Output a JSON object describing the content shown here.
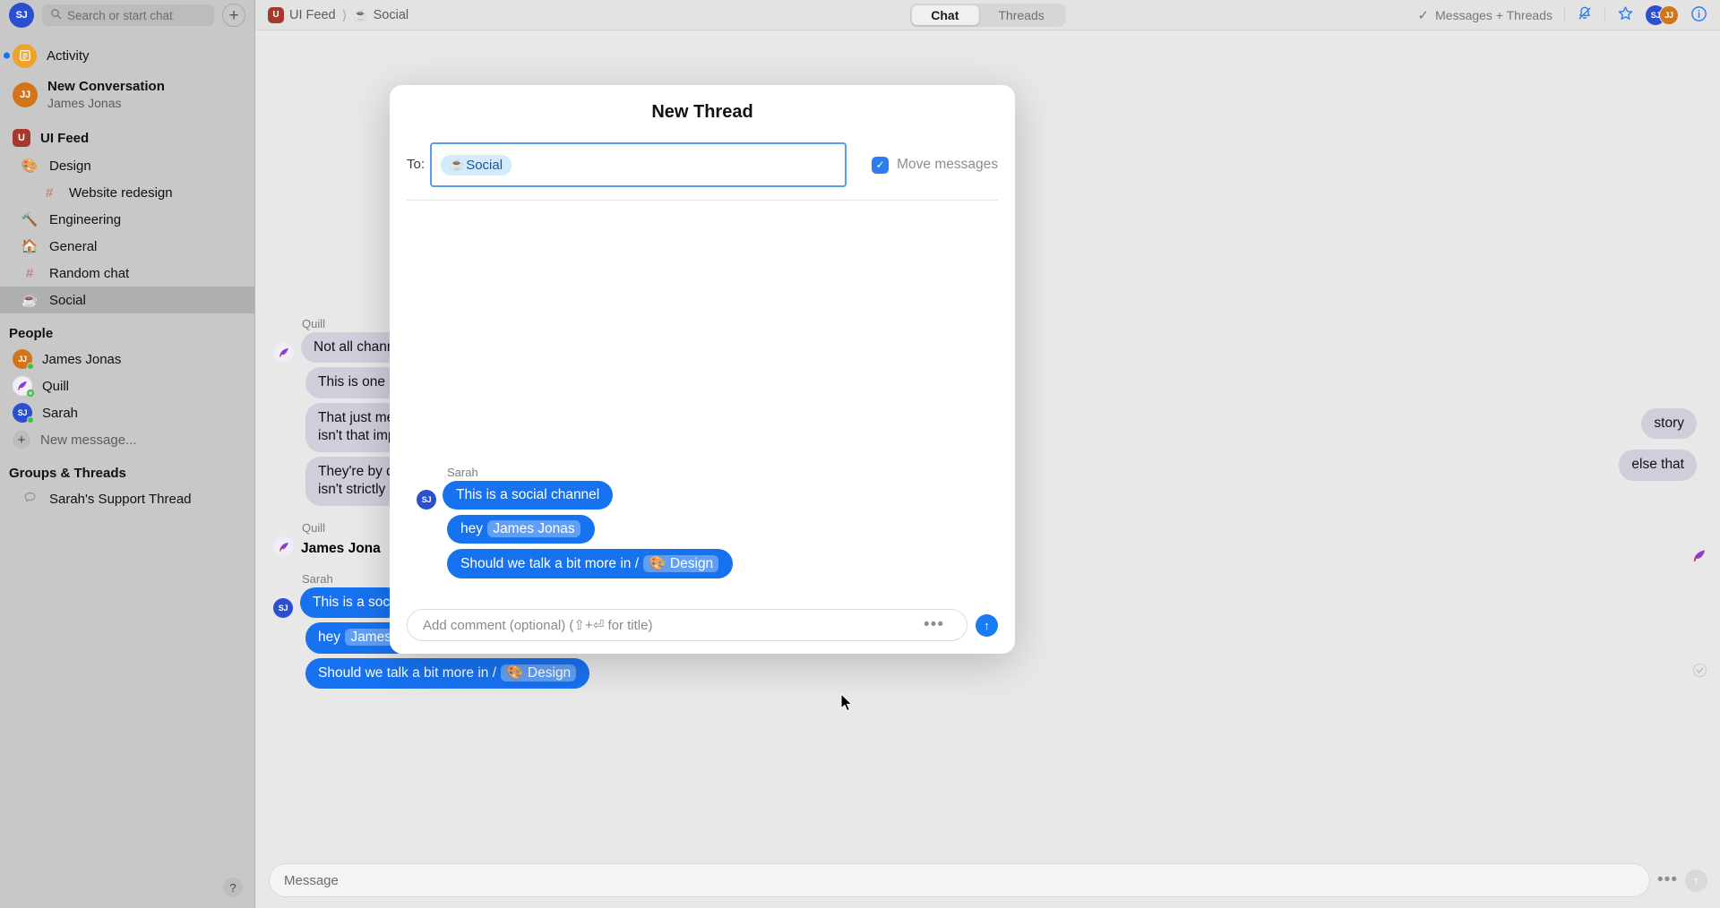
{
  "sidebar": {
    "account_initials": "SJ",
    "search": {
      "placeholder": "Search or start chat",
      "icon": "search-icon"
    },
    "new_button": "+",
    "activity": {
      "label": "Activity",
      "icon": "activity-icon"
    },
    "conversation": {
      "title": "New Conversation",
      "subtitle": "James Jonas",
      "initials": "JJ"
    },
    "workspace": {
      "label": "UI Feed",
      "badge": "U"
    },
    "channels": [
      {
        "label": "Design",
        "icon": "🎨",
        "indent": 1,
        "selected": false
      },
      {
        "label": "Website redesign",
        "icon": "#",
        "indent": 2,
        "selected": false
      },
      {
        "label": "Engineering",
        "icon": "🔨",
        "indent": 1,
        "selected": false
      },
      {
        "label": "General",
        "icon": "🏠",
        "indent": 1,
        "selected": false
      },
      {
        "label": "Random chat",
        "icon": "#",
        "indent": 1,
        "selected": false
      },
      {
        "label": "Social",
        "icon": "☕",
        "indent": 1,
        "selected": true
      }
    ],
    "people_header": "People",
    "people": [
      {
        "name": "James Jonas",
        "initials": "JJ",
        "presence": "online"
      },
      {
        "name": "Quill",
        "initials": "Q",
        "presence": "idle"
      },
      {
        "name": "Sarah",
        "initials": "SJ",
        "presence": "online"
      }
    ],
    "new_message": "New message...",
    "groups_header": "Groups & Threads",
    "groups": [
      {
        "label": "Sarah's Support Thread",
        "icon": "speech-bubble-icon"
      }
    ],
    "help": "?"
  },
  "topbar": {
    "breadcrumb_workspace": "UI Feed",
    "breadcrumb_workspace_badge": "U",
    "breadcrumb_channel": "Social",
    "breadcrumb_channel_icon": "☕",
    "tabs": [
      {
        "label": "Chat",
        "active": true
      },
      {
        "label": "Threads",
        "active": false
      }
    ],
    "filter_label": "Messages + Threads",
    "filter_check": "✓",
    "icons": [
      "bell-muted-icon",
      "star-icon",
      "info-icon"
    ],
    "members": [
      "SJ",
      "JJ"
    ]
  },
  "chat": {
    "left_group_name": "Quill",
    "left_messages": [
      "Not all chann",
      "This is one o",
      "That just me\nisn't that imp",
      "They're by d\nisn't strictly"
    ],
    "right_messages": [
      "story",
      "else that"
    ],
    "second_group_name": "Quill",
    "james_line": "James Jona",
    "sarah_group_name": "Sarah",
    "sarah_messages": [
      {
        "text": "This is a soc"
      },
      {
        "pre": "hey ",
        "mention": "James"
      },
      {
        "pre": "Should we talk a bit more in / ",
        "mention": "🎨 Design"
      }
    ],
    "composer_placeholder": "Message"
  },
  "modal": {
    "title": "New Thread",
    "to_label": "To:",
    "chip": {
      "icon": "☕",
      "label": "Social"
    },
    "move_messages": {
      "label": "Move messages",
      "checked": true,
      "check_glyph": "✓"
    },
    "group_name": "Sarah",
    "avatar_initials": "SJ",
    "messages": [
      {
        "text": "This is a social channel"
      },
      {
        "pre": "hey ",
        "mention": "James Jonas",
        "post": ""
      },
      {
        "pre": "Should we talk a bit more in / ",
        "mention": "🎨 Design",
        "post": ""
      }
    ],
    "composer_placeholder": "Add comment (optional) (⇧+⏎ for title)",
    "more_glyph": "•••",
    "send_glyph": "↑"
  },
  "colors": {
    "accent_blue": "#1772f0",
    "chip_bg": "#d2ecfb",
    "chip_text": "#21529e",
    "sidebar_bg": "#c8c8c8",
    "selected_row": "#b0b0b0",
    "them_bubble": "#cfcfdc"
  }
}
